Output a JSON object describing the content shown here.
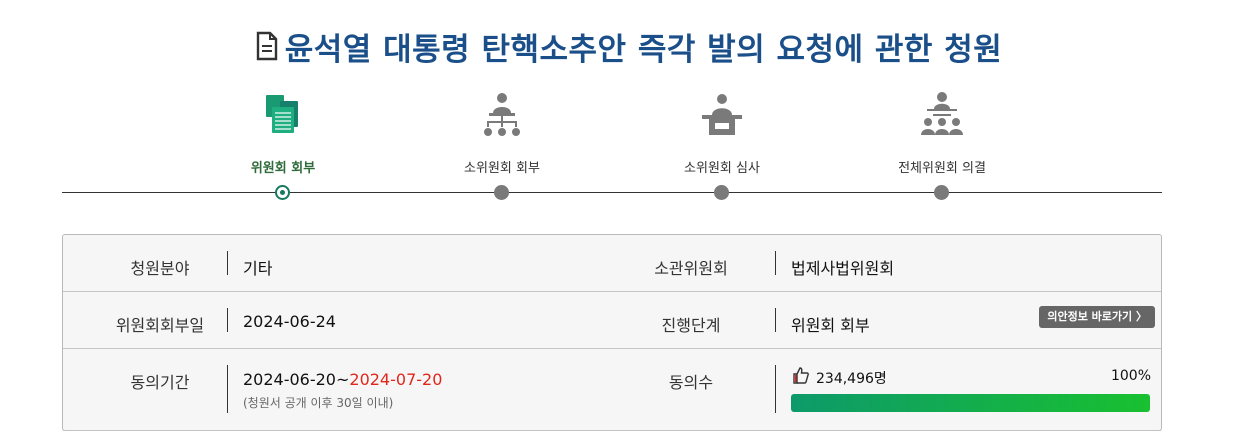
{
  "title": "윤석열 대통령 탄핵소추안 즉각 발의 요청에 관한 청원",
  "steps": [
    {
      "label": "위원회 회부",
      "icon": "documents-stack-icon",
      "active": true
    },
    {
      "label": "소위원회 회부",
      "icon": "org-chart-icon",
      "active": false
    },
    {
      "label": "소위원회 심사",
      "icon": "podium-speaker-icon",
      "active": false
    },
    {
      "label": "전체위원회 의결",
      "icon": "assembly-icon",
      "active": false
    }
  ],
  "info": {
    "field_label": "청원분야",
    "field_value": "기타",
    "committee_label": "소관위원회",
    "committee_value": "법제사법위원회",
    "referral_date_label": "위원회회부일",
    "referral_date_value": "2024-06-24",
    "stage_label": "진행단계",
    "stage_value": "위원회 회부",
    "bill_info_button": "의안정보 바로가기 〉",
    "period_label": "동의기간",
    "period_start": "2024-06-20~",
    "period_end": "2024-07-20",
    "period_note": "(청원서 공개 이후 30일 이내)",
    "agree_label": "동의수",
    "agree_count": "234,496명",
    "agree_percent": "100%",
    "agree_progress": 1.0
  },
  "colors": {
    "title": "#1b4f8a",
    "active_step": "#167a5e",
    "deadline": "#e0261b",
    "progress_start": "#0d9a6a",
    "progress_end": "#19c030"
  }
}
